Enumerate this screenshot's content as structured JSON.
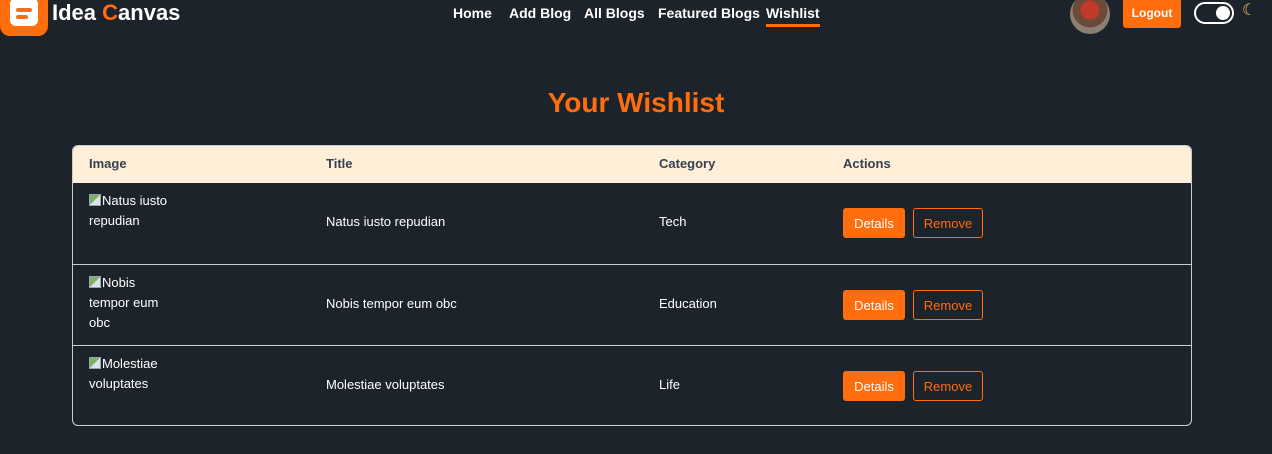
{
  "brand": {
    "name_prefix": "Idea ",
    "name_accent": "C",
    "name_suffix": "anvas"
  },
  "nav": {
    "links": [
      {
        "label": "Home"
      },
      {
        "label": "Add Blog"
      },
      {
        "label": "All Blogs"
      },
      {
        "label": "Featured Blogs"
      },
      {
        "label": "Wishlist",
        "active": true
      }
    ],
    "logout_label": "Logout",
    "theme_toggle": "on",
    "theme_icon": "moon-icon"
  },
  "page": {
    "title": "Your Wishlist"
  },
  "table": {
    "headers": [
      "Image",
      "Title",
      "Category",
      "Actions"
    ],
    "rows": [
      {
        "image_alt": "Natus iusto repudian",
        "title": "Natus iusto repudian",
        "category": "Tech",
        "details_label": "Details",
        "remove_label": "Remove"
      },
      {
        "image_alt": "Nobis tempor eum obc",
        "title": "Nobis tempor eum obc",
        "category": "Education",
        "details_label": "Details",
        "remove_label": "Remove"
      },
      {
        "image_alt": "Molestiae voluptates",
        "title": "Molestiae voluptates",
        "category": "Life",
        "details_label": "Details",
        "remove_label": "Remove"
      }
    ]
  },
  "colors": {
    "accent": "#ff6d0d",
    "background": "#1d232a",
    "table_header_bg": "#ffeed8"
  }
}
